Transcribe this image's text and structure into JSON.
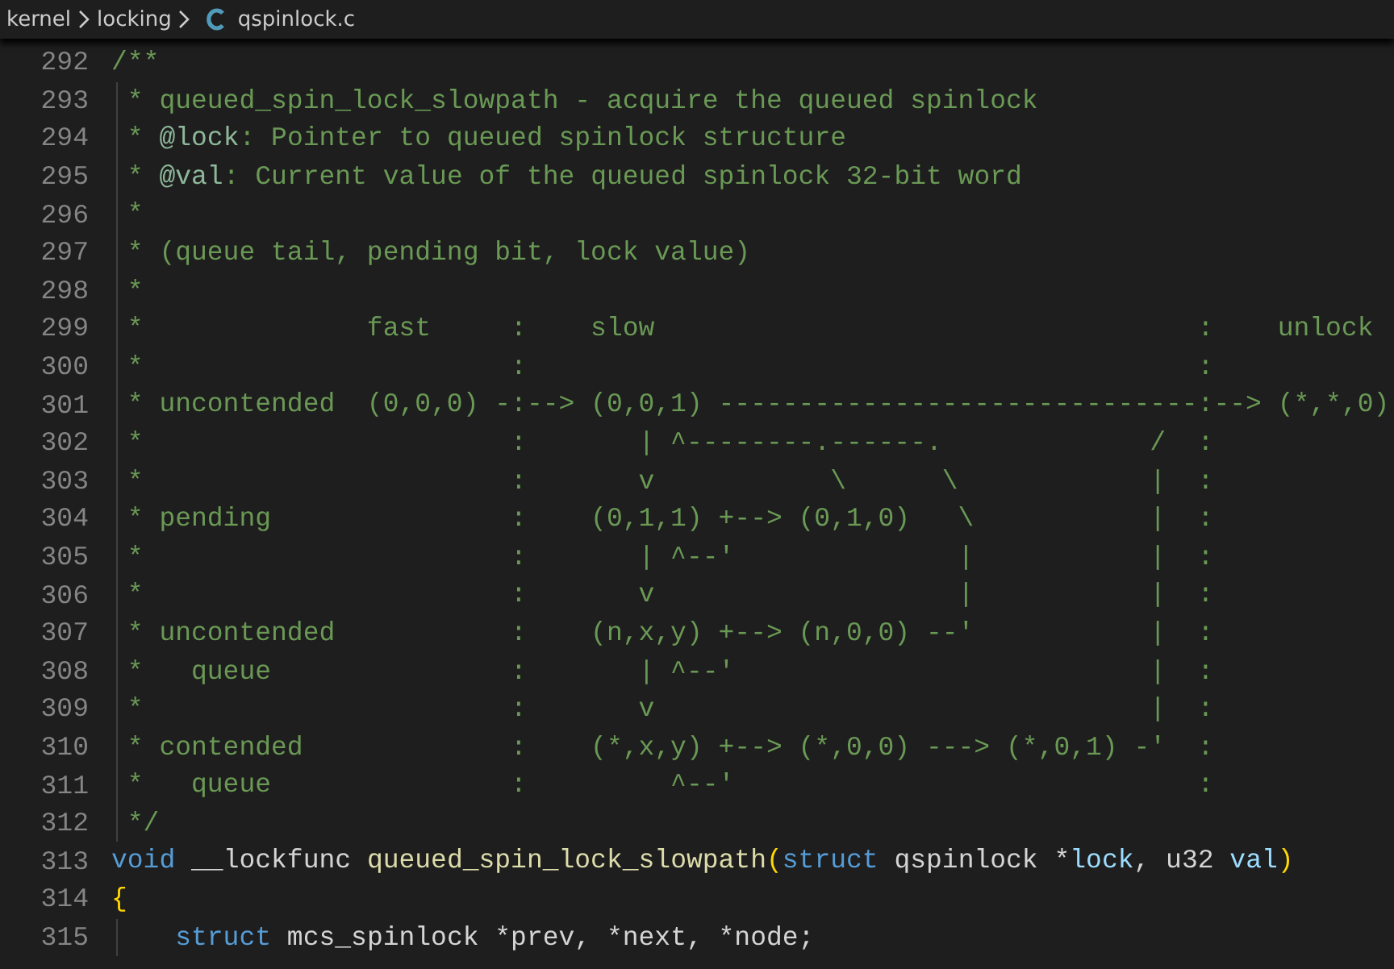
{
  "breadcrumb": [
    {
      "label": "kernel",
      "kind": "folder"
    },
    {
      "label": "locking",
      "kind": "folder"
    },
    {
      "label": "qspinlock.c",
      "kind": "c-file"
    }
  ],
  "lines": [
    {
      "number": "292",
      "indent_guide": false,
      "tokens": [
        {
          "kind": "comment",
          "text": "/**"
        }
      ]
    },
    {
      "number": "293",
      "indent_guide": true,
      "tokens": [
        {
          "kind": "comment",
          "text": " * queued_spin_lock_slowpath - acquire the queued spinlock"
        }
      ]
    },
    {
      "number": "294",
      "indent_guide": true,
      "tokens": [
        {
          "kind": "comment",
          "text": " * "
        },
        {
          "kind": "doctag",
          "text": "@lock"
        },
        {
          "kind": "comment",
          "text": ": Pointer to queued spinlock structure"
        }
      ]
    },
    {
      "number": "295",
      "indent_guide": true,
      "tokens": [
        {
          "kind": "comment",
          "text": " * "
        },
        {
          "kind": "doctag",
          "text": "@val"
        },
        {
          "kind": "comment",
          "text": ": Current value of the queued spinlock 32-bit word"
        }
      ]
    },
    {
      "number": "296",
      "indent_guide": true,
      "tokens": [
        {
          "kind": "comment",
          "text": " *"
        }
      ]
    },
    {
      "number": "297",
      "indent_guide": true,
      "tokens": [
        {
          "kind": "comment",
          "text": " * (queue tail, pending bit, lock value)"
        }
      ]
    },
    {
      "number": "298",
      "indent_guide": true,
      "tokens": [
        {
          "kind": "comment",
          "text": " *"
        }
      ]
    },
    {
      "number": "299",
      "indent_guide": true,
      "tokens": [
        {
          "kind": "comment",
          "text": " *              fast     :    slow                                  :    unlock"
        }
      ]
    },
    {
      "number": "300",
      "indent_guide": true,
      "tokens": [
        {
          "kind": "comment",
          "text": " *                       :                                          :"
        }
      ]
    },
    {
      "number": "301",
      "indent_guide": true,
      "tokens": [
        {
          "kind": "comment",
          "text": " * uncontended  (0,0,0) -:--> (0,0,1) ------------------------------:--> (*,*,0)"
        }
      ]
    },
    {
      "number": "302",
      "indent_guide": true,
      "tokens": [
        {
          "kind": "comment",
          "text": " *                       :       | ^--------.------.             /  :"
        }
      ]
    },
    {
      "number": "303",
      "indent_guide": true,
      "tokens": [
        {
          "kind": "comment",
          "text": " *                       :       v           \\      \\            |  :"
        }
      ]
    },
    {
      "number": "304",
      "indent_guide": true,
      "tokens": [
        {
          "kind": "comment",
          "text": " * pending               :    (0,1,1) +--> (0,1,0)   \\           |  :"
        }
      ]
    },
    {
      "number": "305",
      "indent_guide": true,
      "tokens": [
        {
          "kind": "comment",
          "text": " *                       :       | ^--'              |           |  :"
        }
      ]
    },
    {
      "number": "306",
      "indent_guide": true,
      "tokens": [
        {
          "kind": "comment",
          "text": " *                       :       v                   |           |  :"
        }
      ]
    },
    {
      "number": "307",
      "indent_guide": true,
      "tokens": [
        {
          "kind": "comment",
          "text": " * uncontended           :    (n,x,y) +--> (n,0,0) --'           |  :"
        }
      ]
    },
    {
      "number": "308",
      "indent_guide": true,
      "tokens": [
        {
          "kind": "comment",
          "text": " *   queue               :       | ^--'                          |  :"
        }
      ]
    },
    {
      "number": "309",
      "indent_guide": true,
      "tokens": [
        {
          "kind": "comment",
          "text": " *                       :       v                               |  :"
        }
      ]
    },
    {
      "number": "310",
      "indent_guide": true,
      "tokens": [
        {
          "kind": "comment",
          "text": " * contended             :    (*,x,y) +--> (*,0,0) ---> (*,0,1) -'  :"
        }
      ]
    },
    {
      "number": "311",
      "indent_guide": true,
      "tokens": [
        {
          "kind": "comment",
          "text": " *   queue               :         ^--'                             :"
        }
      ]
    },
    {
      "number": "312",
      "indent_guide": true,
      "tokens": [
        {
          "kind": "comment",
          "text": " */"
        }
      ]
    },
    {
      "number": "313",
      "indent_guide": false,
      "tokens": [
        {
          "kind": "keyword",
          "text": "void"
        },
        {
          "kind": "plain",
          "text": " __lockfunc "
        },
        {
          "kind": "function",
          "text": "queued_spin_lock_slowpath"
        },
        {
          "kind": "bracket",
          "text": "("
        },
        {
          "kind": "keyword",
          "text": "struct"
        },
        {
          "kind": "plain",
          "text": " qspinlock *"
        },
        {
          "kind": "param",
          "text": "lock"
        },
        {
          "kind": "plain",
          "text": ", u32 "
        },
        {
          "kind": "param",
          "text": "val"
        },
        {
          "kind": "bracket",
          "text": ")"
        }
      ]
    },
    {
      "number": "314",
      "indent_guide": false,
      "tokens": [
        {
          "kind": "bracket",
          "text": "{"
        }
      ]
    },
    {
      "number": "315",
      "indent_guide": true,
      "tokens": [
        {
          "kind": "keyword",
          "text": "    struct"
        },
        {
          "kind": "plain",
          "text": " mcs_spinlock *prev, *next, *node;"
        }
      ]
    }
  ]
}
